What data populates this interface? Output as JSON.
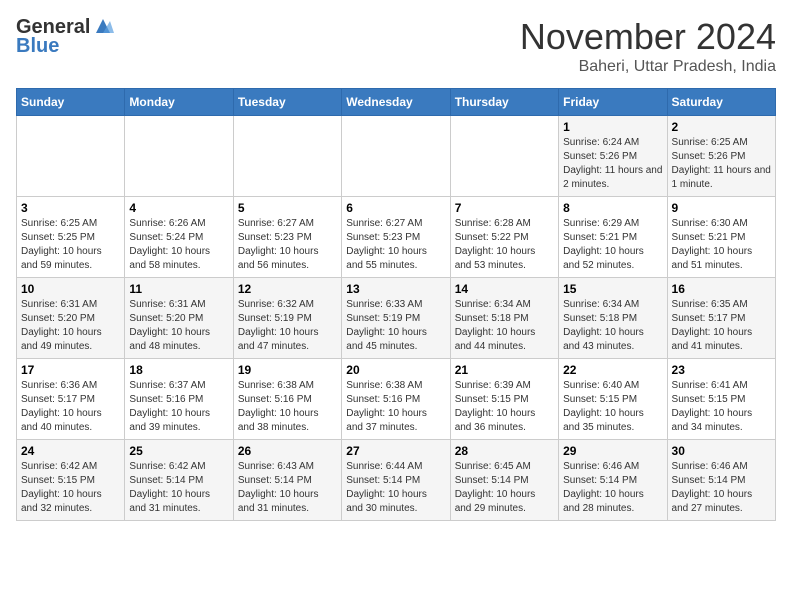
{
  "logo": {
    "line1": "General",
    "line2": "Blue"
  },
  "title": "November 2024",
  "subtitle": "Baheri, Uttar Pradesh, India",
  "headers": [
    "Sunday",
    "Monday",
    "Tuesday",
    "Wednesday",
    "Thursday",
    "Friday",
    "Saturday"
  ],
  "weeks": [
    [
      {
        "day": "",
        "sunrise": "",
        "sunset": "",
        "daylight": ""
      },
      {
        "day": "",
        "sunrise": "",
        "sunset": "",
        "daylight": ""
      },
      {
        "day": "",
        "sunrise": "",
        "sunset": "",
        "daylight": ""
      },
      {
        "day": "",
        "sunrise": "",
        "sunset": "",
        "daylight": ""
      },
      {
        "day": "",
        "sunrise": "",
        "sunset": "",
        "daylight": ""
      },
      {
        "day": "1",
        "sunrise": "Sunrise: 6:24 AM",
        "sunset": "Sunset: 5:26 PM",
        "daylight": "Daylight: 11 hours and 2 minutes."
      },
      {
        "day": "2",
        "sunrise": "Sunrise: 6:25 AM",
        "sunset": "Sunset: 5:26 PM",
        "daylight": "Daylight: 11 hours and 1 minute."
      }
    ],
    [
      {
        "day": "3",
        "sunrise": "Sunrise: 6:25 AM",
        "sunset": "Sunset: 5:25 PM",
        "daylight": "Daylight: 10 hours and 59 minutes."
      },
      {
        "day": "4",
        "sunrise": "Sunrise: 6:26 AM",
        "sunset": "Sunset: 5:24 PM",
        "daylight": "Daylight: 10 hours and 58 minutes."
      },
      {
        "day": "5",
        "sunrise": "Sunrise: 6:27 AM",
        "sunset": "Sunset: 5:23 PM",
        "daylight": "Daylight: 10 hours and 56 minutes."
      },
      {
        "day": "6",
        "sunrise": "Sunrise: 6:27 AM",
        "sunset": "Sunset: 5:23 PM",
        "daylight": "Daylight: 10 hours and 55 minutes."
      },
      {
        "day": "7",
        "sunrise": "Sunrise: 6:28 AM",
        "sunset": "Sunset: 5:22 PM",
        "daylight": "Daylight: 10 hours and 53 minutes."
      },
      {
        "day": "8",
        "sunrise": "Sunrise: 6:29 AM",
        "sunset": "Sunset: 5:21 PM",
        "daylight": "Daylight: 10 hours and 52 minutes."
      },
      {
        "day": "9",
        "sunrise": "Sunrise: 6:30 AM",
        "sunset": "Sunset: 5:21 PM",
        "daylight": "Daylight: 10 hours and 51 minutes."
      }
    ],
    [
      {
        "day": "10",
        "sunrise": "Sunrise: 6:31 AM",
        "sunset": "Sunset: 5:20 PM",
        "daylight": "Daylight: 10 hours and 49 minutes."
      },
      {
        "day": "11",
        "sunrise": "Sunrise: 6:31 AM",
        "sunset": "Sunset: 5:20 PM",
        "daylight": "Daylight: 10 hours and 48 minutes."
      },
      {
        "day": "12",
        "sunrise": "Sunrise: 6:32 AM",
        "sunset": "Sunset: 5:19 PM",
        "daylight": "Daylight: 10 hours and 47 minutes."
      },
      {
        "day": "13",
        "sunrise": "Sunrise: 6:33 AM",
        "sunset": "Sunset: 5:19 PM",
        "daylight": "Daylight: 10 hours and 45 minutes."
      },
      {
        "day": "14",
        "sunrise": "Sunrise: 6:34 AM",
        "sunset": "Sunset: 5:18 PM",
        "daylight": "Daylight: 10 hours and 44 minutes."
      },
      {
        "day": "15",
        "sunrise": "Sunrise: 6:34 AM",
        "sunset": "Sunset: 5:18 PM",
        "daylight": "Daylight: 10 hours and 43 minutes."
      },
      {
        "day": "16",
        "sunrise": "Sunrise: 6:35 AM",
        "sunset": "Sunset: 5:17 PM",
        "daylight": "Daylight: 10 hours and 41 minutes."
      }
    ],
    [
      {
        "day": "17",
        "sunrise": "Sunrise: 6:36 AM",
        "sunset": "Sunset: 5:17 PM",
        "daylight": "Daylight: 10 hours and 40 minutes."
      },
      {
        "day": "18",
        "sunrise": "Sunrise: 6:37 AM",
        "sunset": "Sunset: 5:16 PM",
        "daylight": "Daylight: 10 hours and 39 minutes."
      },
      {
        "day": "19",
        "sunrise": "Sunrise: 6:38 AM",
        "sunset": "Sunset: 5:16 PM",
        "daylight": "Daylight: 10 hours and 38 minutes."
      },
      {
        "day": "20",
        "sunrise": "Sunrise: 6:38 AM",
        "sunset": "Sunset: 5:16 PM",
        "daylight": "Daylight: 10 hours and 37 minutes."
      },
      {
        "day": "21",
        "sunrise": "Sunrise: 6:39 AM",
        "sunset": "Sunset: 5:15 PM",
        "daylight": "Daylight: 10 hours and 36 minutes."
      },
      {
        "day": "22",
        "sunrise": "Sunrise: 6:40 AM",
        "sunset": "Sunset: 5:15 PM",
        "daylight": "Daylight: 10 hours and 35 minutes."
      },
      {
        "day": "23",
        "sunrise": "Sunrise: 6:41 AM",
        "sunset": "Sunset: 5:15 PM",
        "daylight": "Daylight: 10 hours and 34 minutes."
      }
    ],
    [
      {
        "day": "24",
        "sunrise": "Sunrise: 6:42 AM",
        "sunset": "Sunset: 5:15 PM",
        "daylight": "Daylight: 10 hours and 32 minutes."
      },
      {
        "day": "25",
        "sunrise": "Sunrise: 6:42 AM",
        "sunset": "Sunset: 5:14 PM",
        "daylight": "Daylight: 10 hours and 31 minutes."
      },
      {
        "day": "26",
        "sunrise": "Sunrise: 6:43 AM",
        "sunset": "Sunset: 5:14 PM",
        "daylight": "Daylight: 10 hours and 31 minutes."
      },
      {
        "day": "27",
        "sunrise": "Sunrise: 6:44 AM",
        "sunset": "Sunset: 5:14 PM",
        "daylight": "Daylight: 10 hours and 30 minutes."
      },
      {
        "day": "28",
        "sunrise": "Sunrise: 6:45 AM",
        "sunset": "Sunset: 5:14 PM",
        "daylight": "Daylight: 10 hours and 29 minutes."
      },
      {
        "day": "29",
        "sunrise": "Sunrise: 6:46 AM",
        "sunset": "Sunset: 5:14 PM",
        "daylight": "Daylight: 10 hours and 28 minutes."
      },
      {
        "day": "30",
        "sunrise": "Sunrise: 6:46 AM",
        "sunset": "Sunset: 5:14 PM",
        "daylight": "Daylight: 10 hours and 27 minutes."
      }
    ]
  ]
}
